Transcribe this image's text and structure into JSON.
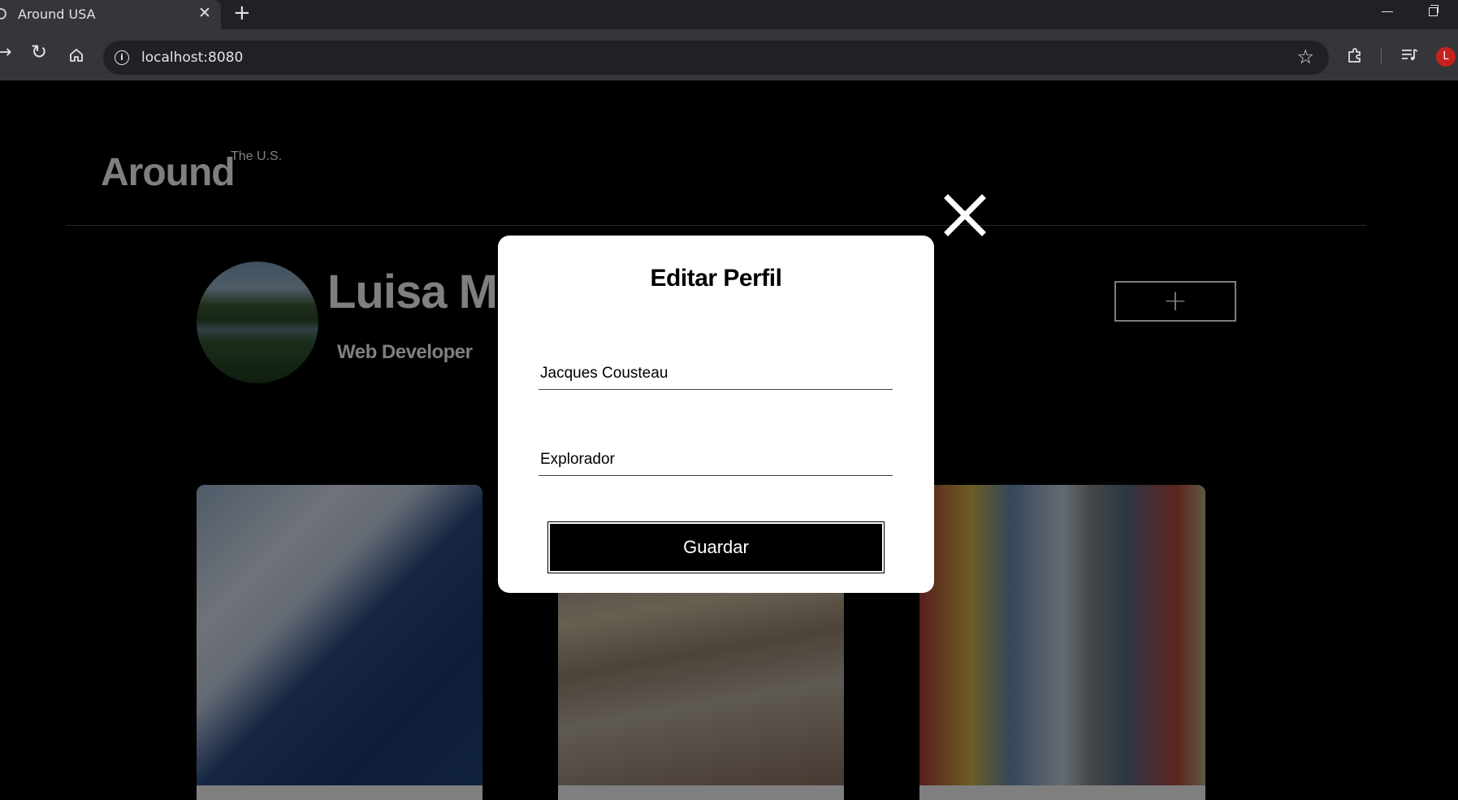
{
  "browser": {
    "tab_title": "Around USA",
    "tab_close": "✕",
    "new_tab": "+",
    "url": "localhost:8080",
    "profile_initial": "L"
  },
  "header": {
    "logo": "Around",
    "logo_superscript": "The U.S."
  },
  "profile": {
    "name": "Luisa Martínez",
    "job": "Web Developer",
    "add_button": "+"
  },
  "cards": [
    {
      "image": "snowy-city-lake"
    },
    {
      "image": "festival-crowd"
    },
    {
      "image": "colorful-street"
    }
  ],
  "modal": {
    "title": "Editar Perfil",
    "name_value": "Jacques Cousteau",
    "about_value": "Explorador",
    "save_label": "Guardar",
    "close_icon": "close-icon"
  }
}
